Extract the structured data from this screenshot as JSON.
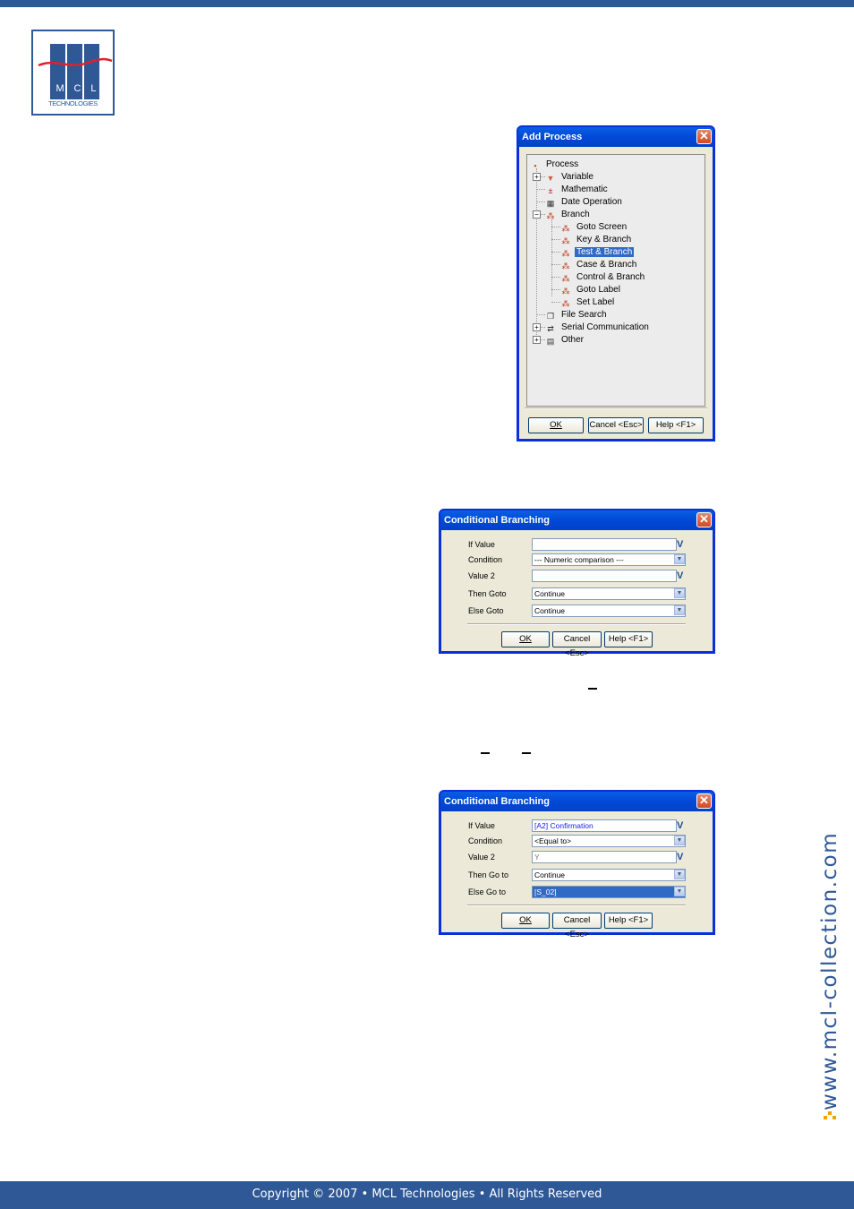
{
  "logo": {
    "letters": [
      "M",
      "C",
      "L"
    ],
    "subtitle": "TECHNOLOGIES"
  },
  "add_process": {
    "title": "Add Process",
    "tree": [
      {
        "label": "Process",
        "icon": "process-icon",
        "level": 0
      },
      {
        "label": "Variable",
        "icon": "variable-icon",
        "level": 1,
        "expander": "+"
      },
      {
        "label": "Mathematic",
        "icon": "mathematic-icon",
        "level": 1
      },
      {
        "label": "Date Operation",
        "icon": "date-operation-icon",
        "level": 1
      },
      {
        "label": "Branch",
        "icon": "branch-icon",
        "level": 1,
        "expander": "-"
      },
      {
        "label": "Goto Screen",
        "icon": "branch-icon",
        "level": 2
      },
      {
        "label": "Key & Branch",
        "icon": "branch-icon",
        "level": 2
      },
      {
        "label": "Test & Branch",
        "icon": "branch-icon",
        "level": 2,
        "selected": true
      },
      {
        "label": "Case & Branch",
        "icon": "branch-icon",
        "level": 2
      },
      {
        "label": "Control & Branch",
        "icon": "branch-icon",
        "level": 2
      },
      {
        "label": "Goto Label",
        "icon": "branch-icon",
        "level": 2
      },
      {
        "label": "Set Label",
        "icon": "branch-icon",
        "level": 2
      },
      {
        "label": "File Search",
        "icon": "file-search-icon",
        "level": 1
      },
      {
        "label": "Serial Communication",
        "icon": "serial-communication-icon",
        "level": 1,
        "expander": "+"
      },
      {
        "label": "Other",
        "icon": "other-icon",
        "level": 1,
        "expander": "+"
      }
    ],
    "buttons": {
      "ok": "OK",
      "cancel": "Cancel <Esc>",
      "help": "Help <F1>"
    }
  },
  "cond1": {
    "title": "Conditional Branching",
    "labels": {
      "if_value": "If Value",
      "condition": "Condition",
      "value2": "Value 2",
      "then": "Then Goto",
      "else": "Else Goto"
    },
    "values": {
      "if_value": "",
      "condition": "--- Numeric comparison ---",
      "value2": "",
      "then": "Continue",
      "else": "Continue"
    },
    "buttons": {
      "ok": "OK",
      "cancel": "Cancel <Esc>",
      "help": "Help <F1>"
    }
  },
  "cond2": {
    "title": "Conditional Branching",
    "labels": {
      "if_value": "If Value",
      "condition": "Condition",
      "value2": "Value 2",
      "then": "Then Go to",
      "else": "Else Go to"
    },
    "values": {
      "if_value": "[A2] Confirmation",
      "condition": "<Equal to>",
      "value2": "Y",
      "then": "Continue",
      "else": "[S_02]"
    },
    "buttons": {
      "ok": "OK",
      "cancel": "Cancel <Esc>",
      "help": "Help <F1>"
    }
  },
  "vertical_url": "www.mcl-collection.com",
  "footer": {
    "text": "Copyright © 2007 • MCL Technologies • All Rights Reserved"
  },
  "colors": {
    "brand": "#2f5896",
    "accent": "#f2a100",
    "xp_title": "#0249d6",
    "selection": "#316ac5"
  }
}
